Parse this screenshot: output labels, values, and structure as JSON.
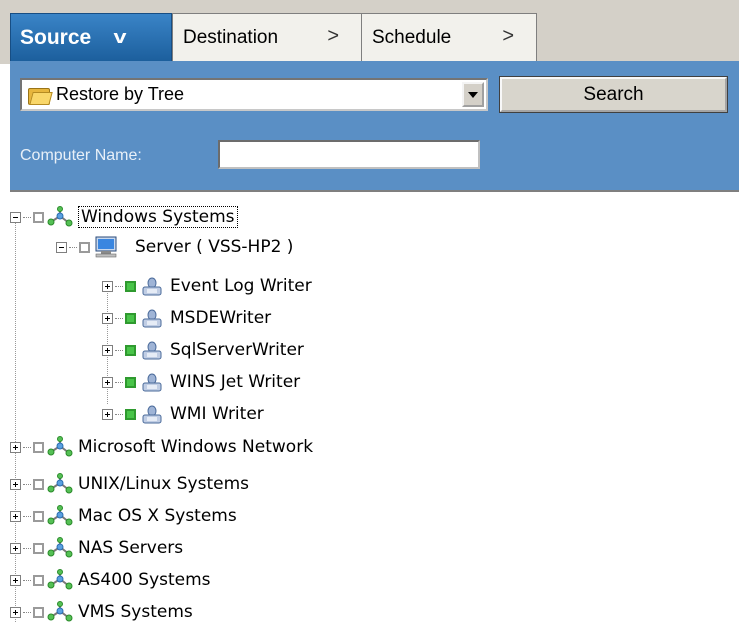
{
  "tabs": [
    {
      "label": "Source",
      "active": true
    },
    {
      "label": "Destination",
      "active": false
    },
    {
      "label": "Schedule",
      "active": false
    }
  ],
  "panel": {
    "view_select": "Restore by Tree",
    "search_button": "Search",
    "computer_name_label": "Computer Name:",
    "computer_name_value": ""
  },
  "tree": {
    "windows_systems": "Windows Systems",
    "server": "Server ( VSS-HP2 )",
    "writers": [
      "Event Log Writer",
      "MSDEWriter",
      "SqlServerWriter",
      "WINS Jet Writer",
      "WMI Writer"
    ],
    "networks": [
      "Microsoft Windows Network",
      "UNIX/Linux Systems",
      "Mac OS X Systems",
      "NAS Servers",
      "AS400 Systems",
      "VMS Systems"
    ]
  },
  "colors": {
    "accent": "#1c5f9d",
    "panel": "#5a8fc5",
    "checked": "#49c449"
  },
  "icons": {
    "network": "network-icon",
    "computer": "computer-icon",
    "writer": "writer-icon",
    "folder": "folder-icon"
  }
}
